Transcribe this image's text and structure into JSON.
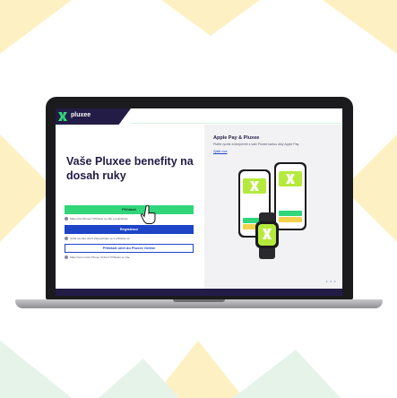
{
  "brand": {
    "name": "pluxee"
  },
  "main": {
    "headline": "Vaše Pluxee benefity na dosah ruky",
    "buttons": {
      "login": "Přihlásit",
      "register": "Registrace",
      "company": "Přihlásit účet do Pluxee Online"
    },
    "hints": {
      "login": "Máte účet Pluxee? Přihlaste se (ID) a pokračujte.",
      "register": "Ještě nemáte účet? Zaregistrujte se a přihlaste se.",
      "company": "Máte firemní účet Pluxee Online? Přihlaste se zde."
    }
  },
  "promo": {
    "title": "Apple Pay & Pluxee",
    "subtitle": "Plaťte rychle a bezpečně s vaší Pluxee kartou díky Apple Pay.",
    "link": "Zjistit více",
    "pager": "• • •"
  },
  "colors": {
    "navy": "#221c46",
    "green": "#31d67b",
    "blue": "#1e44c8",
    "lime": "#b5ea3c",
    "bg_yellow": "#fdf1c4",
    "bg_mint": "#e5f3e9"
  }
}
